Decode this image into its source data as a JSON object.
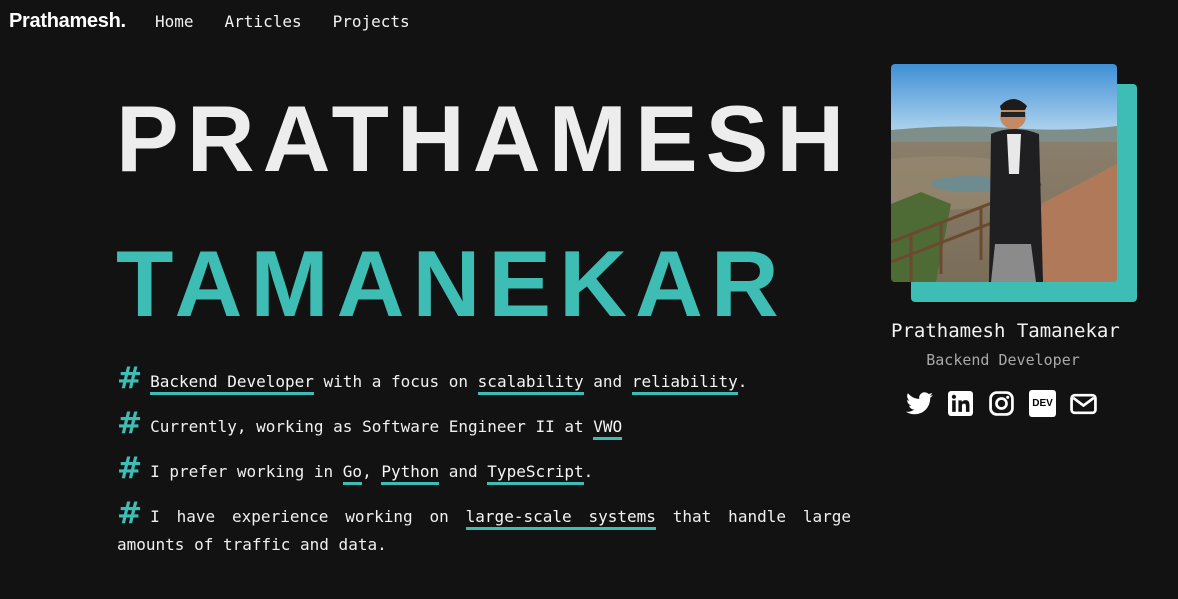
{
  "nav": {
    "brand": "Prathamesh.",
    "links": [
      "Home",
      "Articles",
      "Projects"
    ]
  },
  "hero": {
    "first_name": "PRATHAMESH",
    "last_name": "TAMANEKAR"
  },
  "bullets": [
    {
      "hash": "#",
      "parts": [
        {
          "text": "Backend Developer",
          "highlight": true
        },
        {
          "text": " with a focus on ",
          "highlight": false
        },
        {
          "text": "scalability",
          "highlight": true
        },
        {
          "text": " and ",
          "highlight": false
        },
        {
          "text": "reliability",
          "highlight": true
        },
        {
          "text": ".",
          "highlight": false
        }
      ]
    },
    {
      "hash": "#",
      "parts": [
        {
          "text": "Currently, working as Software Engineer II at ",
          "highlight": false
        },
        {
          "text": "VWO",
          "highlight": true
        }
      ]
    },
    {
      "hash": "#",
      "parts": [
        {
          "text": "I prefer working in ",
          "highlight": false
        },
        {
          "text": "Go",
          "highlight": true
        },
        {
          "text": ", ",
          "highlight": false
        },
        {
          "text": "Python",
          "highlight": true
        },
        {
          "text": " and ",
          "highlight": false
        },
        {
          "text": "TypeScript",
          "highlight": true
        },
        {
          "text": ".",
          "highlight": false
        }
      ]
    },
    {
      "hash": "#",
      "parts": [
        {
          "text": "I have experience working on ",
          "highlight": false
        },
        {
          "text": "large-scale systems",
          "highlight": true
        },
        {
          "text": " that handle large amounts of traffic and data.",
          "highlight": false
        }
      ]
    }
  ],
  "profile": {
    "name": "Prathamesh Tamanekar",
    "role": "Backend Developer",
    "socials": [
      "twitter-icon",
      "linkedin-icon",
      "instagram-icon",
      "dev-icon",
      "mail-icon"
    ],
    "dev_label": "DEV"
  },
  "colors": {
    "accent": "#3dbdb4",
    "background": "#121212",
    "text": "#ededed"
  }
}
